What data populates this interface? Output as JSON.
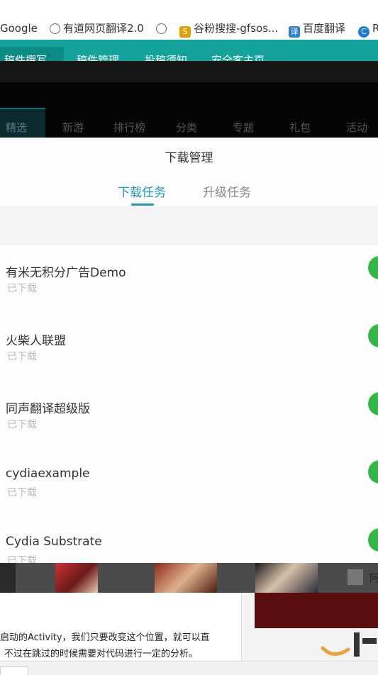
{
  "bookmarks": [
    {
      "label": "Google",
      "icon": "none"
    },
    {
      "label": "有道网页翻译2.0",
      "icon": "globe-icon"
    },
    {
      "label": "",
      "icon": "globe-icon"
    },
    {
      "label": "谷粉搜搜-gfsos...",
      "icon": "s-logo-icon"
    },
    {
      "label": "百度翻译",
      "icon": "translate-icon"
    },
    {
      "label": "R",
      "icon": "c-logo-icon"
    }
  ],
  "top_nav": [
    "稿件撰写",
    "稿件管理",
    "投稿须知",
    "安全客主页"
  ],
  "categories": [
    "精选",
    "新游",
    "排行榜",
    "分类",
    "专题",
    "礼包",
    "活动"
  ],
  "modal": {
    "title": "下载管理",
    "tabs": [
      "下载任务",
      "升级任务"
    ],
    "items": [
      {
        "name": "有米无积分广告Demo",
        "status": "已下载"
      },
      {
        "name": "火柴人联盟",
        "status": "已下载"
      },
      {
        "name": "同声翻译超级版",
        "status": "已下载"
      },
      {
        "name": "cydiaexample",
        "status": "已下载"
      },
      {
        "name": "Cydia Substrate",
        "status": "已下载"
      }
    ]
  },
  "article": {
    "line1": "启动的Activity，我们只要改变这个位置，就可以直",
    "line2": "不过在跳过的时候需要对代码进行一定的分析。"
  },
  "strip_label": "阿",
  "colors": {
    "accent": "#1f9bb0",
    "teal": "#13a39c",
    "green": "#37b44a"
  }
}
